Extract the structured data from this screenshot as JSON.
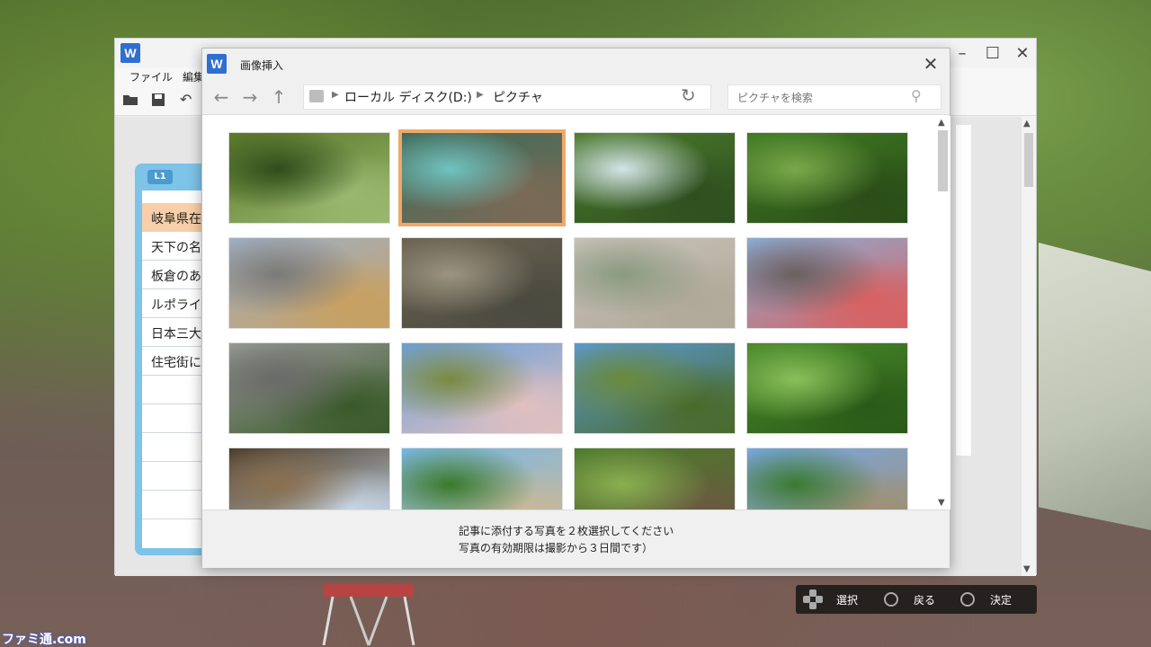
{
  "background_window": {
    "app_icon_letter": "W",
    "menu": [
      "ファイル",
      "編集"
    ],
    "window_controls": [
      "minimize-icon",
      "maximize-icon",
      "close-icon"
    ],
    "toolbar_icons": [
      "folder-open-icon",
      "save-icon",
      "undo-icon"
    ]
  },
  "notes_panel": {
    "tab_label": "L1",
    "items": [
      "岐阜県在",
      "天下の名",
      "板倉のあ",
      "ルポライ",
      "日本三大",
      "住宅街に"
    ],
    "selected_index": 0
  },
  "dialog": {
    "app_icon_letter": "W",
    "title": "画像挿入",
    "close_icon": "close-icon",
    "nav": {
      "back_icon": "arrow-left-icon",
      "forward_icon": "arrow-right-icon",
      "up_icon": "arrow-up-icon"
    },
    "breadcrumb": [
      "ローカル ディスク(D:)",
      "ピクチャ"
    ],
    "refresh_icon": "refresh-icon",
    "search": {
      "placeholder": "ピクチャを検索",
      "icon": "search-icon"
    },
    "thumbnails": [
      {
        "name": "forest-stream",
        "colors": [
          "#5c7a2a",
          "#2f4d1a",
          "#9ab870"
        ],
        "selected": false
      },
      {
        "name": "waterfall-pool",
        "colors": [
          "#3d6a5a",
          "#6fc3c0",
          "#7b6a55"
        ],
        "selected": true
      },
      {
        "name": "waterfall-cliff",
        "colors": [
          "#4b7a2a",
          "#d4e4e8",
          "#2e5020"
        ],
        "selected": false
      },
      {
        "name": "forest-path",
        "colors": [
          "#3f7a22",
          "#79a84a",
          "#2a4d18"
        ],
        "selected": false
      },
      {
        "name": "street-road",
        "colors": [
          "#9fb0c8",
          "#7a7a78",
          "#c8a060"
        ],
        "selected": false
      },
      {
        "name": "stone-steps",
        "colors": [
          "#6a6250",
          "#9c9480",
          "#4a4a40"
        ],
        "selected": false
      },
      {
        "name": "stone-lantern",
        "colors": [
          "#c8c2b8",
          "#8a9a80",
          "#b0a898"
        ],
        "selected": false
      },
      {
        "name": "town-gate",
        "colors": [
          "#8ab0d8",
          "#6a6060",
          "#d86060"
        ],
        "selected": false
      },
      {
        "name": "dragon-statue",
        "colors": [
          "#9a9a98",
          "#6a6a68",
          "#3a5a2a"
        ],
        "selected": false
      },
      {
        "name": "girl-shrine",
        "colors": [
          "#6aa0d8",
          "#7a8a40",
          "#e0c0c0"
        ],
        "selected": false
      },
      {
        "name": "girl-hillside",
        "colors": [
          "#5a9ad8",
          "#6a8a3a",
          "#4a6a2a"
        ],
        "selected": false
      },
      {
        "name": "tree-meadow",
        "colors": [
          "#4a8a2a",
          "#8ac05a",
          "#2a5a18"
        ],
        "selected": false
      },
      {
        "name": "wooden-house",
        "colors": [
          "#4a3a28",
          "#8a7050",
          "#c8d8e8"
        ],
        "selected": false
      },
      {
        "name": "mountain-village",
        "colors": [
          "#78b8e8",
          "#3a7a2a",
          "#c8b898"
        ],
        "selected": false
      },
      {
        "name": "thatched-village",
        "colors": [
          "#4a7a2a",
          "#8ab050",
          "#6a5a40"
        ],
        "selected": false
      },
      {
        "name": "mountain-town",
        "colors": [
          "#78a8e8",
          "#3a7a30",
          "#a09070"
        ],
        "selected": false
      }
    ],
    "footer": [
      "記事に添付する写真を２枚選択してください",
      "写真の有効期限は撮影から３日間です）"
    ]
  },
  "controller_hints": [
    {
      "icon": "dpad-icon",
      "label": "選択"
    },
    {
      "icon": "cross-button-icon",
      "label": "戻る"
    },
    {
      "icon": "circle-button-icon",
      "label": "決定"
    }
  ],
  "watermark": "ファミ通.com"
}
